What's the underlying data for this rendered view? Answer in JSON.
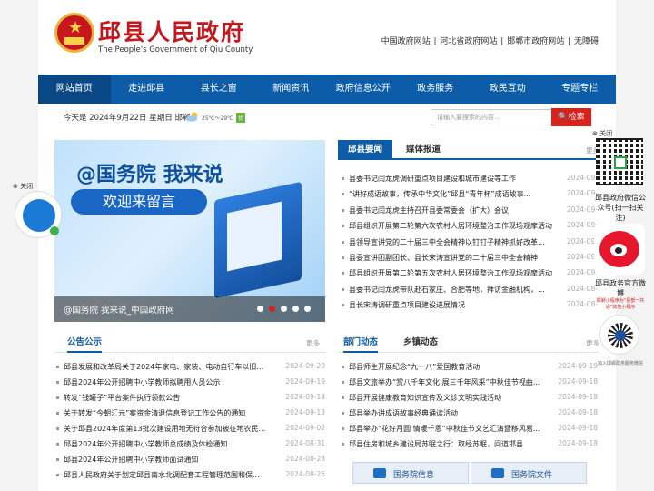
{
  "header": {
    "title": "邱县人民政府",
    "subtitle": "The People's Government of Qiu County",
    "links": [
      "中国政府网站",
      "河北省政府网站",
      "邯郸市政府网站",
      "无障碍"
    ]
  },
  "nav": {
    "items": [
      "网站首页",
      "走进邱县",
      "县长之窗",
      "新闻资讯",
      "政府信息公开",
      "政务服务",
      "政民互动",
      "专题专栏"
    ]
  },
  "datebar": {
    "date": "今天是 2024年9月22日 星期日 邯郸",
    "temp": "25℃～29℃",
    "aqi": "优",
    "search_placeholder": "请输入要搜索的内容...",
    "search_button": "检索"
  },
  "banner": {
    "headline": "@国务院 我来说",
    "pill": "欢迎来留言",
    "caption": "@国务院 我来说_中国政府网"
  },
  "news": {
    "tabs": [
      "邱县要闻",
      "媒体报道"
    ],
    "more": "更多",
    "items": [
      {
        "title": "县委书记闫龙虎调研重点项目建设和城市建设等工作",
        "date": "2024-09-"
      },
      {
        "title": "“讲好成语故事，传承中华文化”邱县“青年杯”成语故事...",
        "date": "2024-09-"
      },
      {
        "title": "县委书记闫龙虎主持召开县委常委会（扩大）会议",
        "date": "2024-09-"
      },
      {
        "title": "邱县组织开展第二轮第六次农村人居环境整治工作现场观摩活动",
        "date": "2024-09-"
      },
      {
        "title": "县领导宣讲党的二十届三中全会精神以钉钉子精神抓好改革...",
        "date": "2024-09-"
      },
      {
        "title": "县委宣讲团副团长、县长宋涛宣讲党的二十届三中全会精神",
        "date": "2024-09-"
      },
      {
        "title": "邱县组织开展第二轮第五次农村人居环境整治工作现场观摩活动",
        "date": "2024-09-"
      },
      {
        "title": "县委书记闫龙虎带队赴石家庄、合肥等地，拜访金融机构，...",
        "date": "2024-08-"
      },
      {
        "title": "县长宋涛调研重点项目建设进展情况",
        "date": "2024-08-"
      }
    ]
  },
  "notices": {
    "tab": "公告公示",
    "more": "更多",
    "items": [
      {
        "title": "邱县发展和改革局关于2024年家电、家装、电动自行车以旧...",
        "date": "2024-09-20"
      },
      {
        "title": "邱县2024年公开招聘中小学教师拟聘用人员公示",
        "date": "2024-09-19"
      },
      {
        "title": "转发“钱罐子”平台案件执行领款公告",
        "date": "2024-09-14"
      },
      {
        "title": "关于转发“今朝汇元”案资金清退信息登记工作公告的通知",
        "date": "2024-09-13"
      },
      {
        "title": "关于邱县2024年度第13批次建设用地无符合参加被征地农民...",
        "date": "2024-09-02"
      },
      {
        "title": "邱县2024年公开招聘中小学教师总成绩及体检通知",
        "date": "2024-08-31"
      },
      {
        "title": "邱县2024年公开招聘中小学教师面试通知",
        "date": "2024-08-28"
      },
      {
        "title": "邱县人民政府关于划定邱县南水北调配套工程管理范围和保...",
        "date": "2024-08-26"
      }
    ]
  },
  "dept": {
    "tabs": [
      "部门动态",
      "乡镇动态"
    ],
    "more": "更多",
    "items": [
      {
        "title": "邱县师生开展纪念“九一八”爱国教育活动",
        "date": "2024-09-19"
      },
      {
        "title": "邱县文旅举办“赏八千年文化 展三千年风采”中秋佳节视曲...",
        "date": "2024-09-18"
      },
      {
        "title": "邱县开展健康教育知识宣传及义诊文明实践活动",
        "date": "2024-09-18"
      },
      {
        "title": "邱县举办讲成语故事经典诵读活动",
        "date": "2024-09-18"
      },
      {
        "title": "邱县举办“花好月圆 情暖千恩”中秋佳节文艺汇演暨移风易...",
        "date": "2024-09-18"
      },
      {
        "title": "邱县住房和城乡建设局苏眠之行：取经苏眠，问道邯县",
        "date": "2024-09-18"
      }
    ]
  },
  "services": [
    "国务院信息",
    "国务院文件"
  ],
  "float_left": {
    "close": "关闭"
  },
  "float_right": {
    "close": "关闭",
    "wechat": "邱县政府微信公众号(扫一扫关注)",
    "weibo": "邱县政务官方微博",
    "mini_caption": "邯郸小程序为“县部一共通”微信小程序",
    "mini_caption2": "加入邯郸政务服务微信"
  }
}
